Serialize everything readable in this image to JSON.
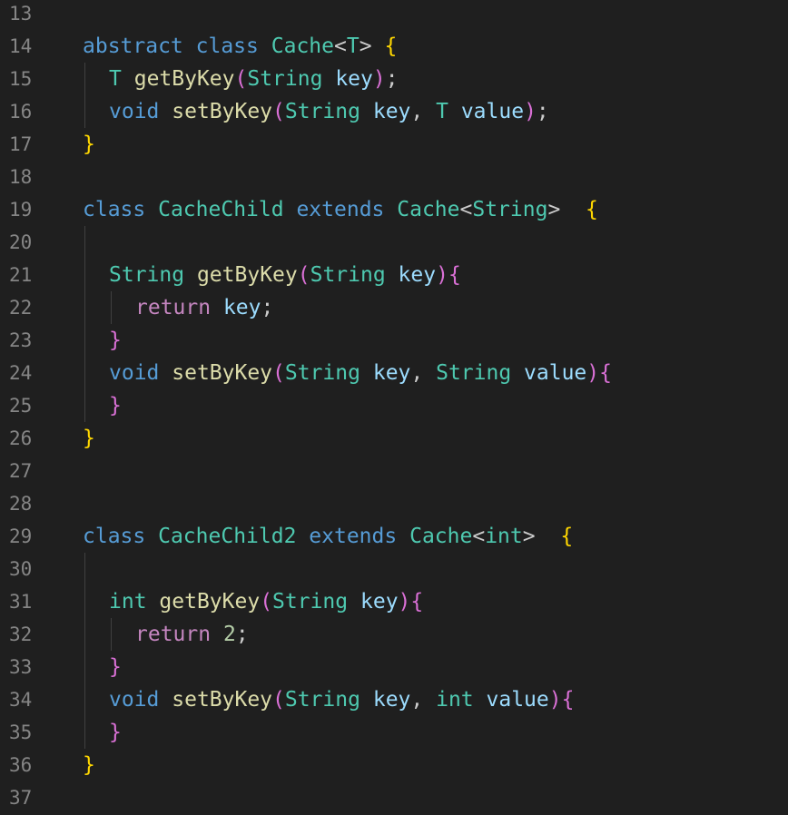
{
  "editor": {
    "background": "#1f1f1f",
    "lines": [
      {
        "number": "13",
        "indent": 0,
        "tokens": []
      },
      {
        "number": "14",
        "indent": 1,
        "tokens": [
          {
            "text": "abstract",
            "color": "#569cd6"
          },
          {
            "text": " ",
            "color": "#cccccc"
          },
          {
            "text": "class",
            "color": "#569cd6"
          },
          {
            "text": " ",
            "color": "#cccccc"
          },
          {
            "text": "Cache",
            "color": "#4ec9b0"
          },
          {
            "text": "<",
            "color": "#cccccc"
          },
          {
            "text": "T",
            "color": "#4ec9b0"
          },
          {
            "text": ">",
            "color": "#cccccc"
          },
          {
            "text": " ",
            "color": "#cccccc"
          },
          {
            "text": "{",
            "color": "#ffd700"
          }
        ]
      },
      {
        "number": "15",
        "indent": 2,
        "tokens": [
          {
            "text": "T",
            "color": "#4ec9b0"
          },
          {
            "text": " ",
            "color": "#cccccc"
          },
          {
            "text": "getByKey",
            "color": "#dcdcaa"
          },
          {
            "text": "(",
            "color": "#da70d6"
          },
          {
            "text": "String",
            "color": "#4ec9b0"
          },
          {
            "text": " ",
            "color": "#cccccc"
          },
          {
            "text": "key",
            "color": "#9cdcfe"
          },
          {
            "text": ")",
            "color": "#da70d6"
          },
          {
            "text": ";",
            "color": "#cccccc"
          }
        ]
      },
      {
        "number": "16",
        "indent": 2,
        "tokens": [
          {
            "text": "void",
            "color": "#569cd6"
          },
          {
            "text": " ",
            "color": "#cccccc"
          },
          {
            "text": "setByKey",
            "color": "#dcdcaa"
          },
          {
            "text": "(",
            "color": "#da70d6"
          },
          {
            "text": "String",
            "color": "#4ec9b0"
          },
          {
            "text": " ",
            "color": "#cccccc"
          },
          {
            "text": "key",
            "color": "#9cdcfe"
          },
          {
            "text": ", ",
            "color": "#cccccc"
          },
          {
            "text": "T",
            "color": "#4ec9b0"
          },
          {
            "text": " ",
            "color": "#cccccc"
          },
          {
            "text": "value",
            "color": "#9cdcfe"
          },
          {
            "text": ")",
            "color": "#da70d6"
          },
          {
            "text": ";",
            "color": "#cccccc"
          }
        ]
      },
      {
        "number": "17",
        "indent": 1,
        "tokens": [
          {
            "text": "}",
            "color": "#ffd700"
          }
        ]
      },
      {
        "number": "18",
        "indent": 0,
        "tokens": []
      },
      {
        "number": "19",
        "indent": 1,
        "tokens": [
          {
            "text": "class",
            "color": "#569cd6"
          },
          {
            "text": " ",
            "color": "#cccccc"
          },
          {
            "text": "CacheChild",
            "color": "#4ec9b0"
          },
          {
            "text": " ",
            "color": "#cccccc"
          },
          {
            "text": "extends",
            "color": "#569cd6"
          },
          {
            "text": " ",
            "color": "#cccccc"
          },
          {
            "text": "Cache",
            "color": "#4ec9b0"
          },
          {
            "text": "<",
            "color": "#cccccc"
          },
          {
            "text": "String",
            "color": "#4ec9b0"
          },
          {
            "text": ">",
            "color": "#cccccc"
          },
          {
            "text": "  ",
            "color": "#cccccc"
          },
          {
            "text": "{",
            "color": "#ffd700"
          }
        ]
      },
      {
        "number": "20",
        "indent": 0,
        "tokens": []
      },
      {
        "number": "21",
        "indent": 2,
        "tokens": [
          {
            "text": "String",
            "color": "#4ec9b0"
          },
          {
            "text": " ",
            "color": "#cccccc"
          },
          {
            "text": "getByKey",
            "color": "#dcdcaa"
          },
          {
            "text": "(",
            "color": "#da70d6"
          },
          {
            "text": "String",
            "color": "#4ec9b0"
          },
          {
            "text": " ",
            "color": "#cccccc"
          },
          {
            "text": "key",
            "color": "#9cdcfe"
          },
          {
            "text": ")",
            "color": "#da70d6"
          },
          {
            "text": "{",
            "color": "#da70d6"
          }
        ]
      },
      {
        "number": "22",
        "indent": 3,
        "tokens": [
          {
            "text": "return",
            "color": "#c586c0"
          },
          {
            "text": " ",
            "color": "#cccccc"
          },
          {
            "text": "key",
            "color": "#9cdcfe"
          },
          {
            "text": ";",
            "color": "#cccccc"
          }
        ]
      },
      {
        "number": "23",
        "indent": 2,
        "tokens": [
          {
            "text": "}",
            "color": "#da70d6"
          }
        ]
      },
      {
        "number": "24",
        "indent": 2,
        "tokens": [
          {
            "text": "void",
            "color": "#569cd6"
          },
          {
            "text": " ",
            "color": "#cccccc"
          },
          {
            "text": "setByKey",
            "color": "#dcdcaa"
          },
          {
            "text": "(",
            "color": "#da70d6"
          },
          {
            "text": "String",
            "color": "#4ec9b0"
          },
          {
            "text": " ",
            "color": "#cccccc"
          },
          {
            "text": "key",
            "color": "#9cdcfe"
          },
          {
            "text": ", ",
            "color": "#cccccc"
          },
          {
            "text": "String",
            "color": "#4ec9b0"
          },
          {
            "text": " ",
            "color": "#cccccc"
          },
          {
            "text": "value",
            "color": "#9cdcfe"
          },
          {
            "text": ")",
            "color": "#da70d6"
          },
          {
            "text": "{",
            "color": "#da70d6"
          }
        ]
      },
      {
        "number": "25",
        "indent": 2,
        "tokens": [
          {
            "text": "}",
            "color": "#da70d6"
          }
        ]
      },
      {
        "number": "26",
        "indent": 1,
        "tokens": [
          {
            "text": "}",
            "color": "#ffd700"
          }
        ]
      },
      {
        "number": "27",
        "indent": 0,
        "tokens": []
      },
      {
        "number": "28",
        "indent": 0,
        "tokens": []
      },
      {
        "number": "29",
        "indent": 1,
        "tokens": [
          {
            "text": "class",
            "color": "#569cd6"
          },
          {
            "text": " ",
            "color": "#cccccc"
          },
          {
            "text": "CacheChild2",
            "color": "#4ec9b0"
          },
          {
            "text": " ",
            "color": "#cccccc"
          },
          {
            "text": "extends",
            "color": "#569cd6"
          },
          {
            "text": " ",
            "color": "#cccccc"
          },
          {
            "text": "Cache",
            "color": "#4ec9b0"
          },
          {
            "text": "<",
            "color": "#cccccc"
          },
          {
            "text": "int",
            "color": "#4ec9b0"
          },
          {
            "text": ">",
            "color": "#cccccc"
          },
          {
            "text": "  ",
            "color": "#cccccc"
          },
          {
            "text": "{",
            "color": "#ffd700"
          }
        ]
      },
      {
        "number": "30",
        "indent": 0,
        "tokens": []
      },
      {
        "number": "31",
        "indent": 2,
        "tokens": [
          {
            "text": "int",
            "color": "#4ec9b0"
          },
          {
            "text": " ",
            "color": "#cccccc"
          },
          {
            "text": "getByKey",
            "color": "#dcdcaa"
          },
          {
            "text": "(",
            "color": "#da70d6"
          },
          {
            "text": "String",
            "color": "#4ec9b0"
          },
          {
            "text": " ",
            "color": "#cccccc"
          },
          {
            "text": "key",
            "color": "#9cdcfe"
          },
          {
            "text": ")",
            "color": "#da70d6"
          },
          {
            "text": "{",
            "color": "#da70d6"
          }
        ]
      },
      {
        "number": "32",
        "indent": 3,
        "tokens": [
          {
            "text": "return",
            "color": "#c586c0"
          },
          {
            "text": " ",
            "color": "#cccccc"
          },
          {
            "text": "2",
            "color": "#b5cea8"
          },
          {
            "text": ";",
            "color": "#cccccc"
          }
        ]
      },
      {
        "number": "33",
        "indent": 2,
        "tokens": [
          {
            "text": "}",
            "color": "#da70d6"
          }
        ]
      },
      {
        "number": "34",
        "indent": 2,
        "tokens": [
          {
            "text": "void",
            "color": "#569cd6"
          },
          {
            "text": " ",
            "color": "#cccccc"
          },
          {
            "text": "setByKey",
            "color": "#dcdcaa"
          },
          {
            "text": "(",
            "color": "#da70d6"
          },
          {
            "text": "String",
            "color": "#4ec9b0"
          },
          {
            "text": " ",
            "color": "#cccccc"
          },
          {
            "text": "key",
            "color": "#9cdcfe"
          },
          {
            "text": ", ",
            "color": "#cccccc"
          },
          {
            "text": "int",
            "color": "#4ec9b0"
          },
          {
            "text": " ",
            "color": "#cccccc"
          },
          {
            "text": "value",
            "color": "#9cdcfe"
          },
          {
            "text": ")",
            "color": "#da70d6"
          },
          {
            "text": "{",
            "color": "#da70d6"
          }
        ]
      },
      {
        "number": "35",
        "indent": 2,
        "tokens": [
          {
            "text": "}",
            "color": "#da70d6"
          }
        ]
      },
      {
        "number": "36",
        "indent": 1,
        "tokens": [
          {
            "text": "}",
            "color": "#ffd700"
          }
        ]
      },
      {
        "number": "37",
        "indent": 0,
        "tokens": []
      }
    ]
  }
}
